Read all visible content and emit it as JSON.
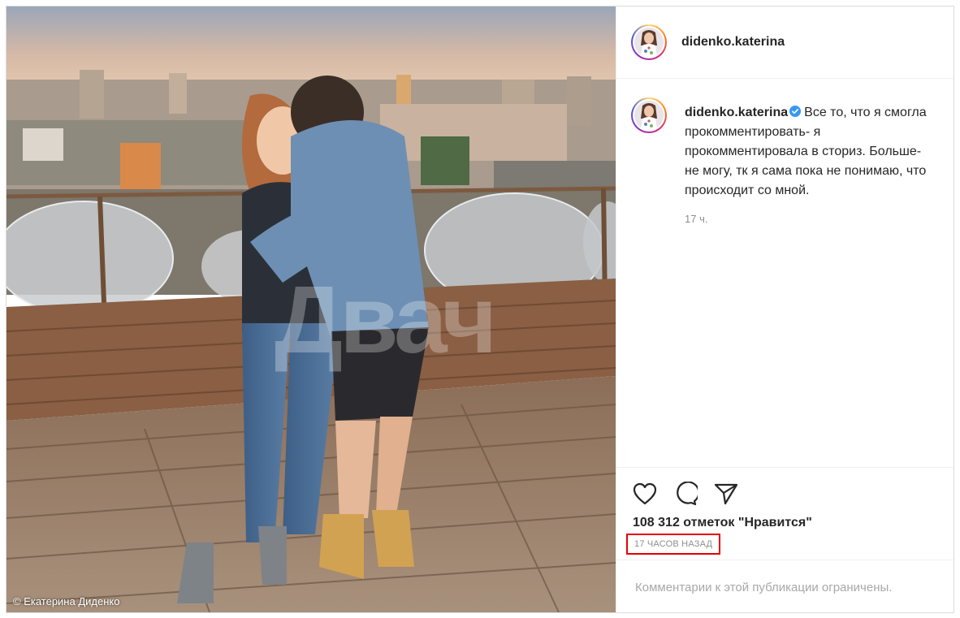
{
  "post": {
    "username": "didenko.katerina",
    "caption": "Все то, что я смогла прокомментировать- я прокомментировала в сториз. Больше- не могу, тк я сама пока не понимаю, что происходит со мной.",
    "caption_time": "17 ч.",
    "likes": "108 312 отметок \"Нравится\"",
    "timestamp": "17 ЧАСОВ НАЗАД",
    "comments_disabled": "Комментарии к этой публикации ограничены."
  },
  "photo": {
    "credit": "© Екатерина Диденко",
    "watermark": "Двач"
  },
  "icons": {
    "like": "heart-icon",
    "comment": "comment-icon",
    "share": "share-icon",
    "verified": "verified-badge-icon"
  },
  "colors": {
    "highlight_border": "#e60000",
    "verified": "#3897f0",
    "muted_text": "#8e8e8e"
  }
}
